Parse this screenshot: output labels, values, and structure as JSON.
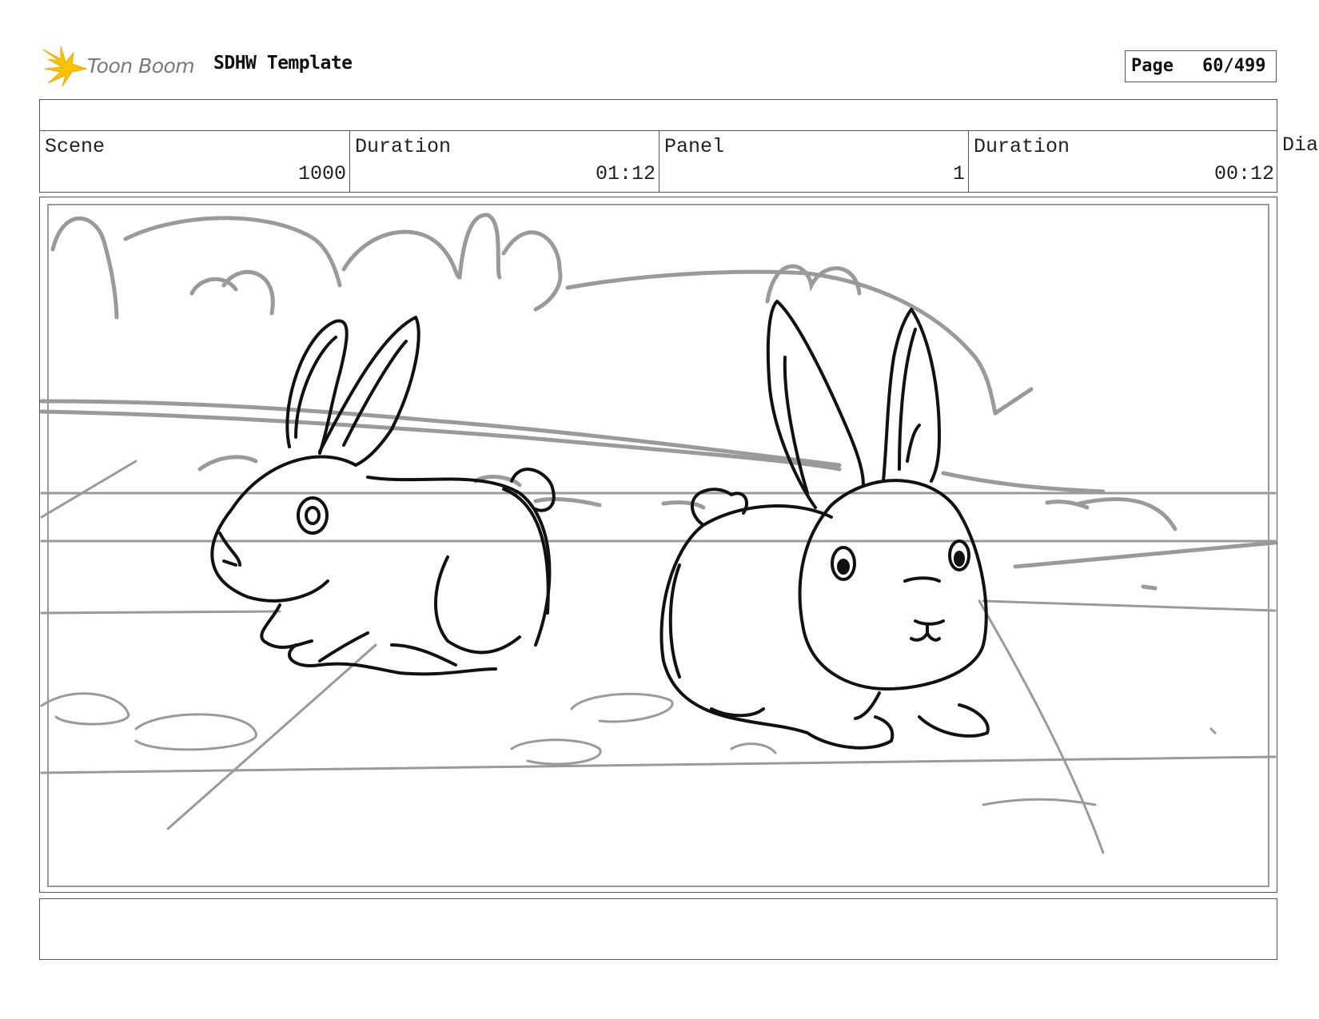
{
  "header": {
    "logo_text": "Toon Boom",
    "logo_icon": "toon-boom-starburst-icon",
    "doc_title": "SDHW Template",
    "page_label": "Page",
    "page_value": "60/499"
  },
  "info": {
    "scene_label": "Scene",
    "scene_value": "1000",
    "scene_duration_label": "Duration",
    "scene_duration_value": "01:12",
    "panel_label": "Panel",
    "panel_value": "1",
    "panel_duration_label": "Duration",
    "panel_duration_value": "00:12",
    "dialogue_label": "Dia"
  },
  "colors": {
    "line": "#555555",
    "ink": "#111111",
    "background_sketch": "#9a9a9a",
    "logo_yellow": "#f5c400"
  },
  "notes": {
    "text": ""
  }
}
